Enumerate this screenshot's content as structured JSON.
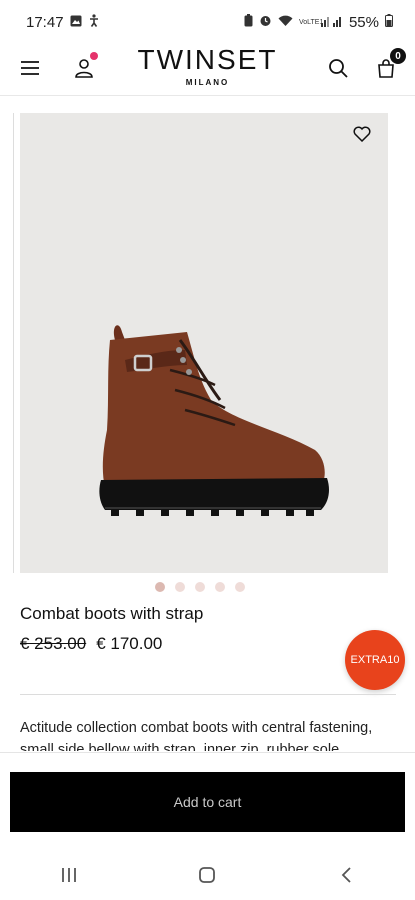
{
  "status_bar": {
    "time": "17:47",
    "battery": "55%",
    "left_icons": [
      "gallery-icon",
      "accessibility-icon"
    ],
    "right_icons": [
      "battery-saver-icon",
      "alarm-icon",
      "wifi-icon",
      "volte-icon",
      "signal-icon"
    ],
    "volte_label": "VoLTE1"
  },
  "header": {
    "logo": "TWINSET",
    "logo_sub": "MILANO",
    "cart_count": "0",
    "icons": [
      "menu-icon",
      "user-icon",
      "search-icon",
      "bag-icon"
    ]
  },
  "product": {
    "title": "Combat boots with strap",
    "old_price": "€ 253.00",
    "price": "€ 170.00",
    "description": "Actitude collection combat boots with central fastening, small side bellow with strap, inner zip, rubber sole.",
    "gallery": {
      "slides": 5,
      "active_index": 0
    }
  },
  "promo": {
    "badge": "EXTRA10",
    "color": "#e8431c"
  },
  "cta": {
    "label": "Add to cart"
  },
  "system_nav": {
    "icons": [
      "recent-apps-icon",
      "home-icon",
      "back-icon"
    ]
  }
}
